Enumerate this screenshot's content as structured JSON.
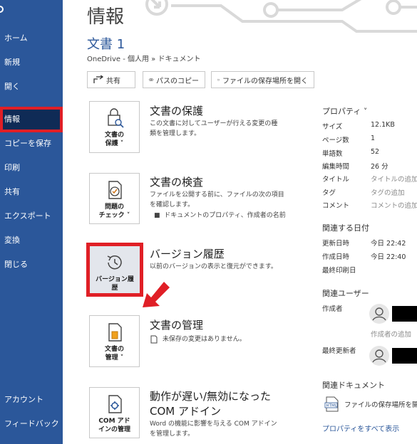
{
  "sidebar": {
    "items": [
      {
        "label": "ホーム"
      },
      {
        "label": "新規"
      },
      {
        "label": "開く"
      },
      {
        "label": "情報"
      },
      {
        "label": "コピーを保存"
      },
      {
        "label": "印刷"
      },
      {
        "label": "共有"
      },
      {
        "label": "エクスポート"
      },
      {
        "label": "変換"
      },
      {
        "label": "閉じる"
      }
    ],
    "bottom": [
      {
        "label": "アカウント"
      },
      {
        "label": "フィードバック"
      }
    ]
  },
  "header": {
    "page_title": "情報",
    "doc_title": "文書 1",
    "path": "OneDrive - 個人用 » ドキュメント"
  },
  "toolbar": {
    "share_label": "共有",
    "copy_path_label": "パスのコピー",
    "open_location_label": "ファイルの保存場所を開く"
  },
  "sections": {
    "protect": {
      "tile_label_1": "文書の",
      "tile_label_2": "保護",
      "heading": "文書の保護",
      "desc_1": "この文書に対してユーザーが行える変更の種",
      "desc_2": "類を管理します。"
    },
    "inspect": {
      "tile_label_1": "問題の",
      "tile_label_2": "チェック",
      "heading": "文書の検査",
      "desc_1": "ファイルを公開する前に、ファイルの次の項目",
      "desc_2": "を確認します。",
      "bullet": "ドキュメントのプロパティ、作成者の名前"
    },
    "version": {
      "tile_label_1": "バージョン履",
      "tile_label_2": "歴",
      "heading": "バージョン履歴",
      "desc_1": "以前のバージョンの表示と復元ができます。"
    },
    "manage": {
      "tile_label_1": "文書の",
      "tile_label_2": "管理",
      "heading": "文書の管理",
      "desc_1": "未保存の変更はありません。"
    },
    "com": {
      "tile_label_1": "COM アド",
      "tile_label_2": "インの管理",
      "heading_1": "動作が遅い/無効になった",
      "heading_2": "COM アドイン",
      "desc_1": "Word の機能に影響を与える COM アドイン",
      "desc_2": "を管理します。"
    }
  },
  "properties": {
    "heading": "プロパティ",
    "rows": [
      {
        "key": "サイズ",
        "value": "12.1KB"
      },
      {
        "key": "ページ数",
        "value": "1"
      },
      {
        "key": "単語数",
        "value": "52"
      },
      {
        "key": "編集時間",
        "value": "26 分"
      },
      {
        "key": "タイトル",
        "value": "タイトルの追加"
      },
      {
        "key": "タグ",
        "value": "タグの追加"
      },
      {
        "key": "コメント",
        "value": "コメントの追加"
      }
    ]
  },
  "dates": {
    "heading": "関連する日付",
    "rows": [
      {
        "key": "更新日時",
        "value": "今日 22:42"
      },
      {
        "key": "作成日時",
        "value": "今日 22:40"
      },
      {
        "key": "最終印刷日",
        "value": ""
      }
    ]
  },
  "users": {
    "heading": "関連ユーザー",
    "author_label": "作成者",
    "add_author": "作成者の追加",
    "last_modified_label": "最終更新者"
  },
  "related_docs": {
    "heading": "関連ドキュメント",
    "open_location": "ファイルの保存場所を開く",
    "show_all": "プロパティをすべて表示"
  },
  "colors": {
    "sidebar": "#2b579a",
    "sidebar_active": "#0f2b56",
    "highlight_red": "#e01f26",
    "accent": "#2b579a"
  }
}
